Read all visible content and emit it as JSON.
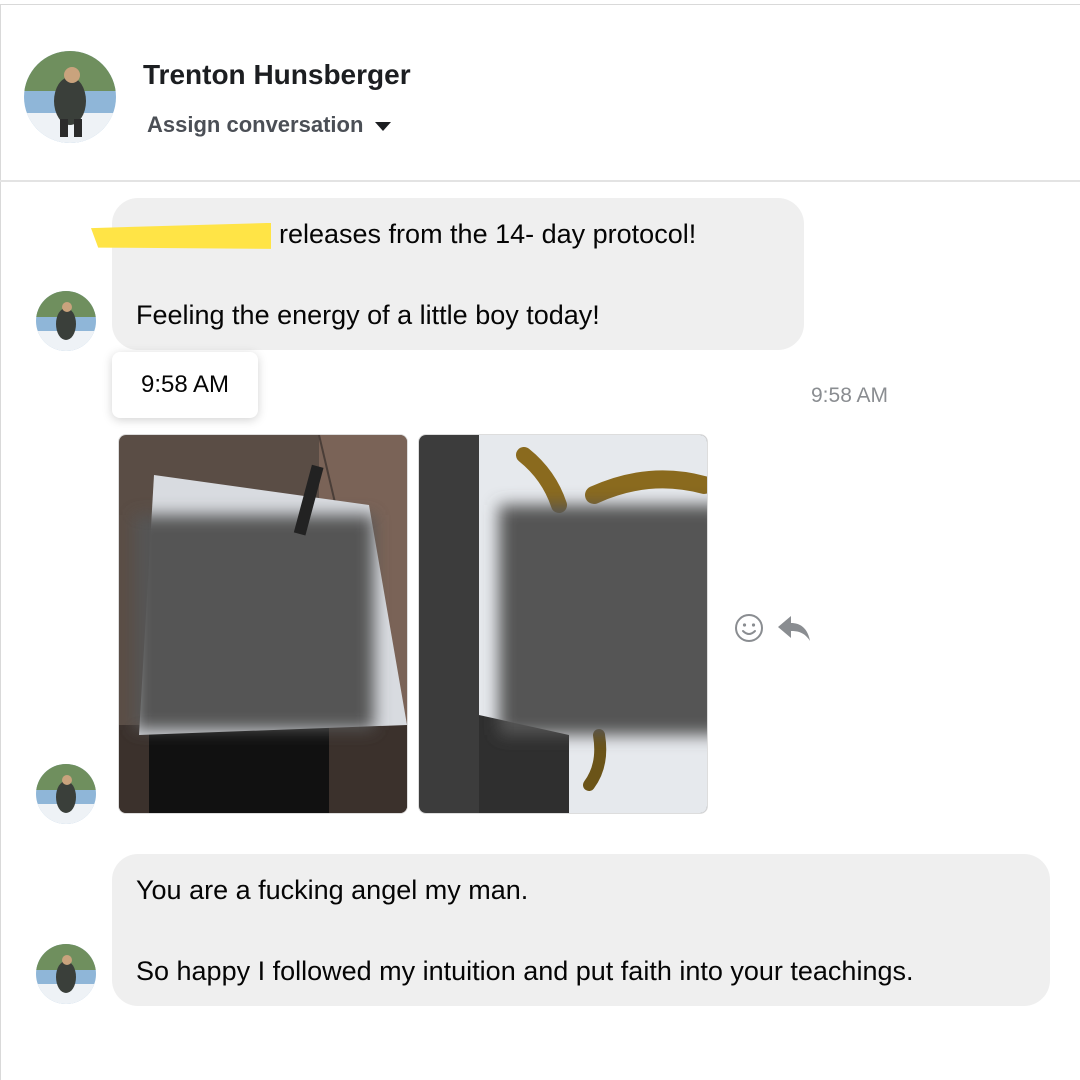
{
  "header": {
    "contact_name": "Trenton Hunsberger",
    "assign_label": "Assign conversation"
  },
  "messages": [
    {
      "sender": "contact",
      "lines": [
        "releases from the 14-  day protocol!",
        "Feeling the energy of a little boy today!"
      ],
      "tooltip_time": "9:58 AM"
    },
    {
      "sender": "contact",
      "type": "photos",
      "timestamp": "9:58 AM",
      "photo_count": 2
    },
    {
      "sender": "contact",
      "lines": [
        "You are a fucking angel my man.",
        "So happy I followed my intuition and put faith into your teachings."
      ]
    }
  ],
  "actions": {
    "react_icon": "smiley-icon",
    "reply_icon": "reply-arrow-icon"
  },
  "colors": {
    "bubble": "#efefef",
    "redaction": "#ffe446",
    "timestamp": "#8a8d91"
  }
}
